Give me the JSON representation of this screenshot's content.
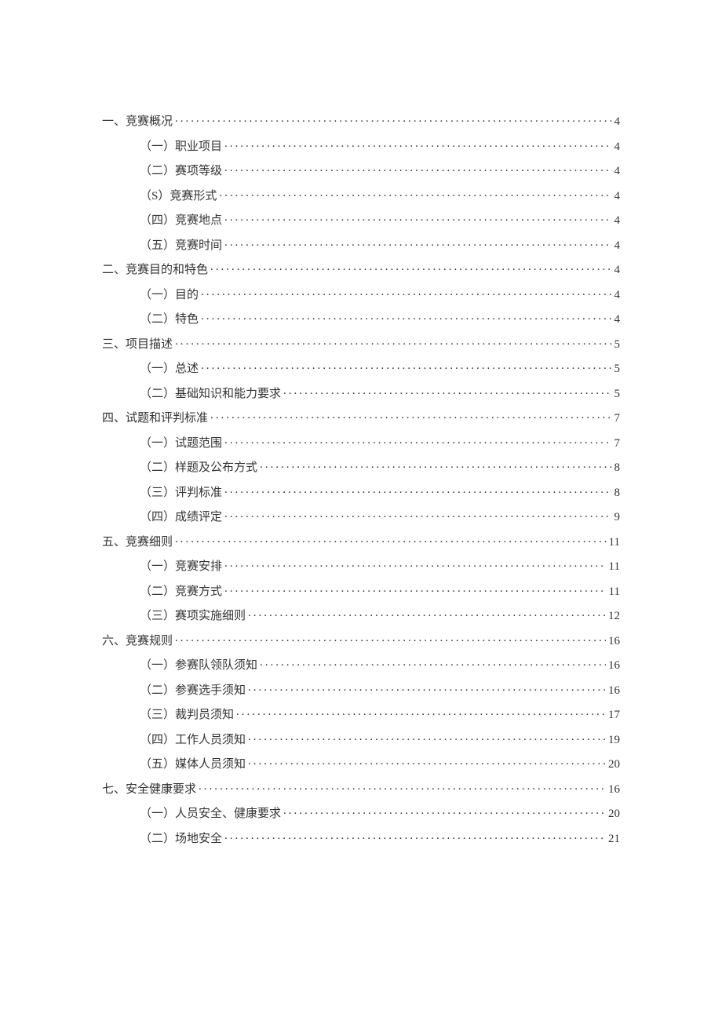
{
  "toc": [
    {
      "level": 1,
      "label": "一、竞赛概况",
      "page": "4"
    },
    {
      "level": 2,
      "label": "（一）职业项目",
      "page": "4"
    },
    {
      "level": 2,
      "label": "（二）赛项等级",
      "page": "4"
    },
    {
      "level": 2,
      "label": "（S）竞赛形式",
      "page": "4"
    },
    {
      "level": 2,
      "label": "（四）竞赛地点",
      "page": "4"
    },
    {
      "level": 2,
      "label": "（五）竞赛时间",
      "page": "4"
    },
    {
      "level": 1,
      "label": "二、竞赛目的和特色",
      "page": "4"
    },
    {
      "level": 2,
      "label": "（一）目的",
      "page": "4"
    },
    {
      "level": 2,
      "label": "（二）特色",
      "page": "4"
    },
    {
      "level": 1,
      "label": "三、项目描述",
      "page": "5"
    },
    {
      "level": 2,
      "label": "（一）总述",
      "page": "5"
    },
    {
      "level": 2,
      "label": "（二）基础知识和能力要求",
      "page": "5"
    },
    {
      "level": 1,
      "label": "四、试题和评判标准",
      "page": "7"
    },
    {
      "level": 2,
      "label": "（一）试题范围",
      "page": "7"
    },
    {
      "level": 2,
      "label": "（二）样题及公布方式",
      "page": "8"
    },
    {
      "level": 2,
      "label": "（三）评判标准",
      "page": "8"
    },
    {
      "level": 2,
      "label": "（四）成绩评定",
      "page": "9"
    },
    {
      "level": 1,
      "label": "五、竞赛细则",
      "page": "11"
    },
    {
      "level": 2,
      "label": "（一）竞赛安排",
      "page": "11"
    },
    {
      "level": 2,
      "label": "（二）竞赛方式",
      "page": "11"
    },
    {
      "level": 2,
      "label": "（三）赛项实施细则",
      "page": "12"
    },
    {
      "level": 1,
      "label": "六、竞赛规则",
      "page": "16"
    },
    {
      "level": 2,
      "label": "（一）参赛队领队须知",
      "page": "16"
    },
    {
      "level": 2,
      "label": "（二）参赛选手须知",
      "page": "16"
    },
    {
      "level": 2,
      "label": "（三）裁判员须知",
      "page": "17"
    },
    {
      "level": 2,
      "label": "（四）工作人员须知",
      "page": "19"
    },
    {
      "level": 2,
      "label": "（五）媒体人员须知",
      "page": "20"
    },
    {
      "level": 1,
      "label": "七、安全健康要求",
      "page": "16"
    },
    {
      "level": 2,
      "label": "（一）人员安全、健康要求",
      "page": "20"
    },
    {
      "level": 2,
      "label": "（二）场地安全",
      "page": "21"
    }
  ]
}
